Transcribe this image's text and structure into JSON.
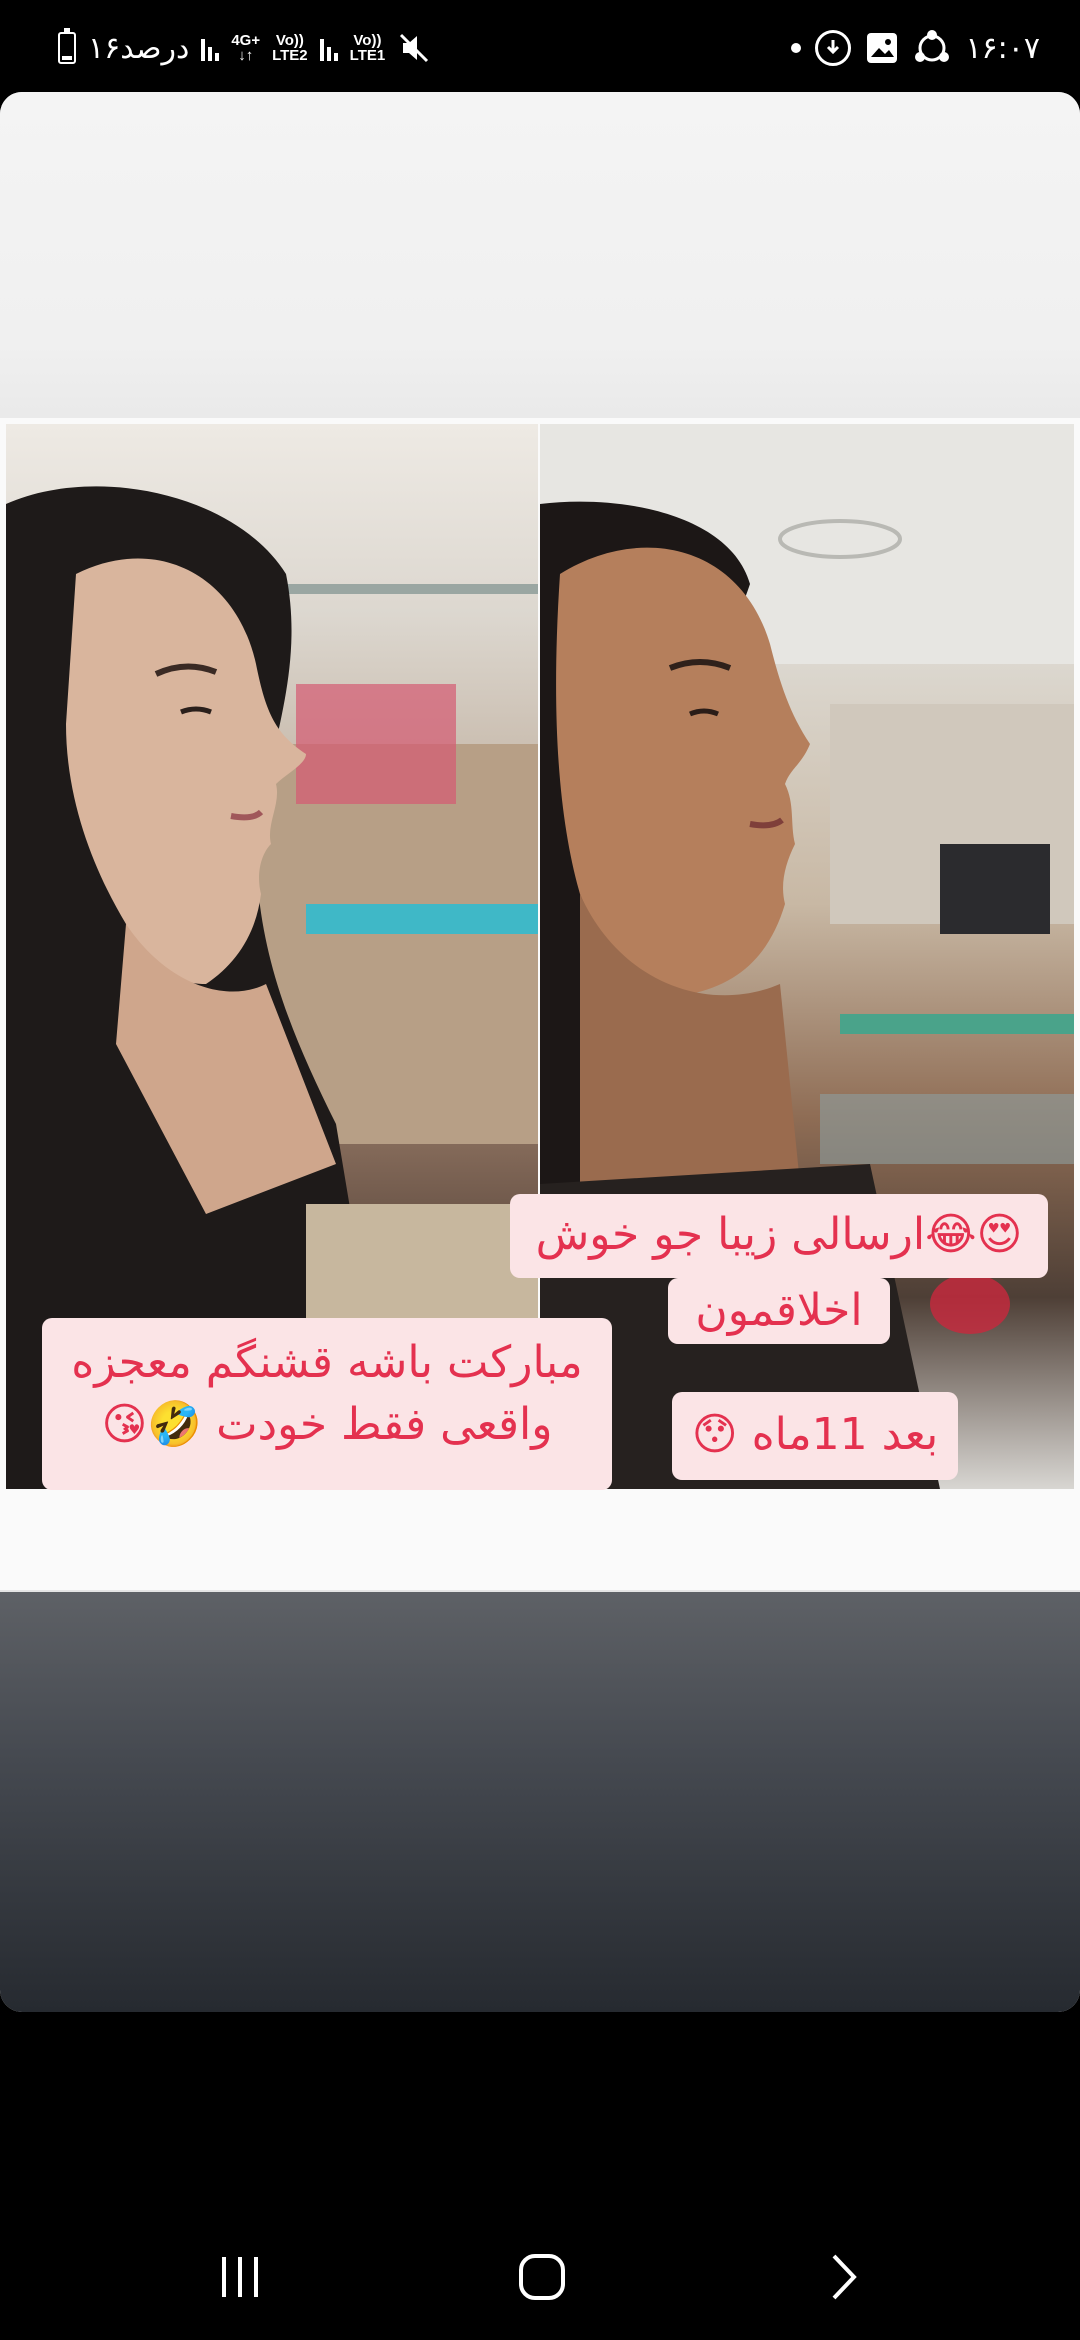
{
  "status_bar": {
    "battery_text": "۱۶درصد",
    "network_1": "4G+",
    "lte_2_top": "Vo))",
    "lte_2_bottom": "LTE2",
    "lte_1_top": "Vo))",
    "lte_1_bottom": "LTE1",
    "time": "۱۶:۰۷"
  },
  "captions": {
    "left_line_1": "مبارکت باشه قشنگم معجزه",
    "left_line_2": "واقعی فقط خودت 🤣😘",
    "right_top_line_1": "😍😂ارسالی زیبا جو  خوش",
    "right_top_line_2": "اخلاقمون",
    "right_bottom": "بعد 11ماه 😯"
  },
  "colors": {
    "caption_text": "#e4314f",
    "caption_bg": "#fbe4e6"
  }
}
